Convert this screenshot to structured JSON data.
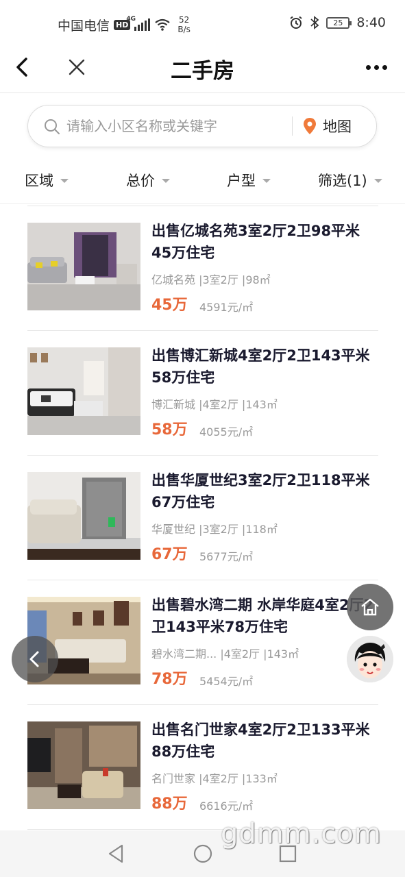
{
  "status_bar": {
    "carrier": "中国电信",
    "hd_badge": "HD",
    "network": "4G",
    "speed_value": "52",
    "speed_unit": "B/s",
    "battery": "25",
    "time": "8:40"
  },
  "header": {
    "title": "二手房",
    "back_icon": "chevron-left-icon",
    "close_icon": "close-icon",
    "more_icon": "more-dots-icon"
  },
  "search": {
    "placeholder": "请输入小区名称或关键字",
    "map_label": "地图",
    "map_icon_color": "#f07a3a"
  },
  "filters": {
    "area": "区域",
    "total_price": "总价",
    "layout": "户型",
    "more": "筛选(1)"
  },
  "listings": [
    {
      "title": "出售亿城名苑3室2厅2卫98平米45万住宅",
      "meta": "亿城名苑 |3室2厅 |98㎡",
      "price": "45万",
      "unit_price": "4591元/㎡"
    },
    {
      "title": "出售博汇新城4室2厅2卫143平米58万住宅",
      "meta": "博汇新城 |4室2厅 |143㎡",
      "price": "58万",
      "unit_price": "4055元/㎡"
    },
    {
      "title": "出售华厦世纪3室2厅2卫118平米67万住宅",
      "meta": "华厦世纪 |3室2厅 |118㎡",
      "price": "67万",
      "unit_price": "5677元/㎡"
    },
    {
      "title": "出售碧水湾二期 水岸华庭4室2厅2卫143平米78万住宅",
      "meta": "碧水湾二期... |4室2厅 |143㎡",
      "price": "78万",
      "unit_price": "5454元/㎡"
    },
    {
      "title": "出售名门世家4室2厅2卫133平米88万住宅",
      "meta": "名门世家 |4室2厅 |133㎡",
      "price": "88万",
      "unit_price": "6616元/㎡"
    }
  ],
  "colors": {
    "price": "#e8683a",
    "title": "#1a1a2e",
    "meta": "#999999"
  },
  "watermark": "gdmm.com"
}
